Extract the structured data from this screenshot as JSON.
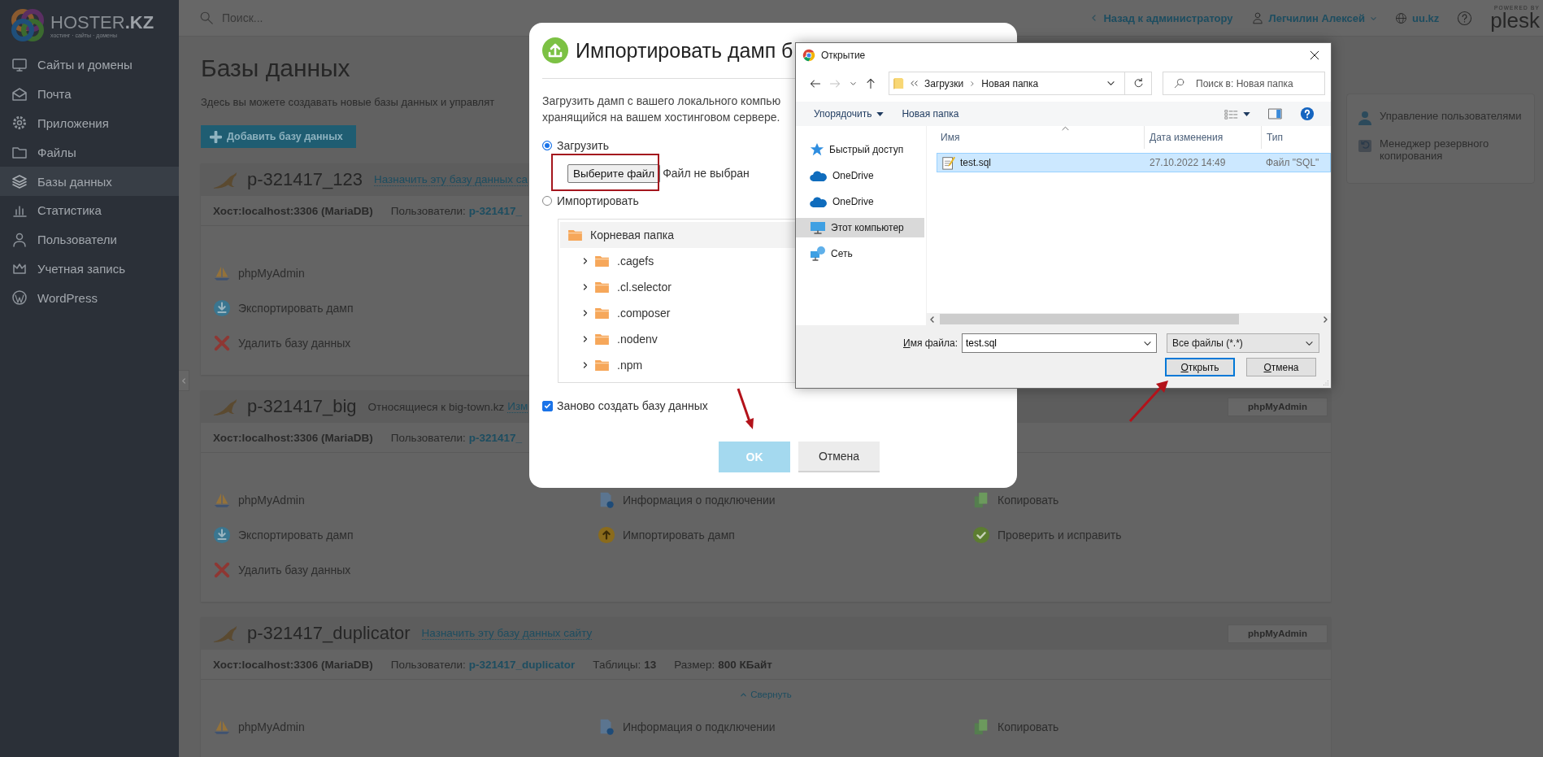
{
  "brand": {
    "name": "HOSTER",
    "suffix": ".KZ",
    "tagline": "хостинг · сайты · домены"
  },
  "sidebar": {
    "items": [
      {
        "label": "Сайты и домены",
        "selected": false
      },
      {
        "label": "Почта",
        "selected": false
      },
      {
        "label": "Приложения",
        "selected": false
      },
      {
        "label": "Файлы",
        "selected": false
      },
      {
        "label": "Базы данных",
        "selected": true
      },
      {
        "label": "Статистика",
        "selected": false
      },
      {
        "label": "Пользователи",
        "selected": false
      },
      {
        "label": "Учетная запись",
        "selected": false
      },
      {
        "label": "WordPress",
        "selected": false
      }
    ]
  },
  "header": {
    "search_placeholder": "Поиск...",
    "back_link": "Назад к администратору",
    "user": "Легчилин Алексей",
    "domain": "uu.kz",
    "powered_by": "POWERED BY",
    "logo": "plesk"
  },
  "page": {
    "title": "Базы данных",
    "description": "Здесь вы можете создавать новые базы данных и управлят",
    "add_button": "Добавить базу данных"
  },
  "databases": [
    {
      "name": "p-321417_123",
      "link": "Назначить эту базу данных са",
      "host": "Хост:localhost:3306 (MariaDB)",
      "users_label": "Пользователи:",
      "users": "p-321417_",
      "actions": [
        [
          {
            "kind": "phpmyadmin",
            "label": "phpMyAdmin"
          }
        ],
        [
          {
            "kind": "export",
            "label": "Экспортировать дамп"
          }
        ],
        [
          {
            "kind": "delete",
            "label": "Удалить базу данных"
          }
        ]
      ]
    },
    {
      "name": "p-321417_big",
      "relation": "Относящиеся к big-town.kz",
      "link": "Изм",
      "button": "phpMyAdmin",
      "host": "Хост:localhost:3306 (MariaDB)",
      "users_label": "Пользователи:",
      "users": "p-321417_",
      "actions": [
        [
          {
            "kind": "phpmyadmin",
            "label": "phpMyAdmin"
          },
          {
            "kind": "info",
            "label": "Информация о подключении"
          },
          {
            "kind": "copy",
            "label": "Копировать"
          }
        ],
        [
          {
            "kind": "export",
            "label": "Экспортировать дамп"
          },
          {
            "kind": "import",
            "label": "Импортировать дамп"
          },
          {
            "kind": "check",
            "label": "Проверить и исправить"
          }
        ],
        [
          {
            "kind": "delete",
            "label": "Удалить базу данных"
          }
        ]
      ]
    },
    {
      "name": "p-321417_duplicator",
      "link": "Назначить эту базу данных сайту",
      "button": "phpMyAdmin",
      "host": "Хост:localhost:3306 (MariaDB)",
      "users_label": "Пользователи:",
      "users": "p-321417_duplicator",
      "stats": [
        {
          "label": "Таблицы:",
          "value": "13"
        },
        {
          "label": "Размер:",
          "value": "800 КБайт"
        }
      ],
      "collapse": "Свернуть",
      "actions": [
        [
          {
            "kind": "phpmyadmin",
            "label": "phpMyAdmin"
          },
          {
            "kind": "info",
            "label": "Информация о подключении"
          },
          {
            "kind": "copy",
            "label": "Копировать"
          }
        ]
      ]
    }
  ],
  "right_panel": {
    "items": [
      {
        "kind": "users",
        "label": "Управление пользователями"
      },
      {
        "kind": "backup",
        "label": "Менеджер резервного копирования"
      }
    ]
  },
  "modal": {
    "title": "Импортировать дамп б",
    "description": [
      "Загрузить дамп с вашего локального компью",
      "хранящийся на вашем хостинговом сервере."
    ],
    "options": [
      {
        "label": "Загрузить",
        "selected": true
      },
      {
        "label": "Импортировать",
        "selected": false
      }
    ],
    "file_button": "Выберите файл",
    "file_status": "Файл не выбран",
    "tree": {
      "root": {
        "label": "Корневая папка",
        "selected": true
      },
      "children": [
        {
          "label": ".cagefs",
          "expanded": false,
          "selected": false
        },
        {
          "label": ".cl.selector",
          "expanded": false,
          "selected": false
        },
        {
          "label": ".composer",
          "expanded": false,
          "selected": false
        },
        {
          "label": ".nodenv",
          "expanded": false,
          "selected": false
        },
        {
          "label": ".npm",
          "expanded": false,
          "selected": false
        }
      ]
    },
    "recreate": {
      "label": "Заново создать базу данных",
      "checked": true
    },
    "buttons": [
      {
        "label": "OK",
        "kind": "primary",
        "disabled": true
      },
      {
        "label": "Отмена",
        "kind": "secondary",
        "disabled": false
      }
    ]
  },
  "file_dialog": {
    "title": "Открытие",
    "path": [
      "Загрузки",
      "Новая папка"
    ],
    "search_placeholder": "Поиск в: Новая папка",
    "toolbar": [
      "Упорядочить",
      "Новая папка"
    ],
    "nav": [
      {
        "kind": "quick",
        "label": "Быстрый доступ",
        "selected": false
      },
      {
        "kind": "cloud",
        "label": "OneDrive",
        "selected": false
      },
      {
        "kind": "cloud",
        "label": "OneDrive",
        "selected": false
      },
      {
        "kind": "pc",
        "label": "Этот компьютер",
        "selected": true
      },
      {
        "kind": "network",
        "label": "Сеть",
        "selected": false
      }
    ],
    "columns": [
      "Имя",
      "Дата изменения",
      "Тип"
    ],
    "files": [
      {
        "name": "test.sql",
        "date": "27.10.2022 14:49",
        "type": "Файл \"SQL\"",
        "selected": true
      }
    ],
    "filename_label": "Имя файла:",
    "filename": "test.sql",
    "filter": "Все файлы (*.*)",
    "buttons": [
      {
        "label": "Открыть",
        "kind": "default"
      },
      {
        "label": "Отмена",
        "kind": "normal"
      }
    ]
  },
  "annotations": [
    {
      "kind": "frame"
    },
    {
      "kind": "arrow"
    },
    {
      "kind": "arrow"
    }
  ]
}
